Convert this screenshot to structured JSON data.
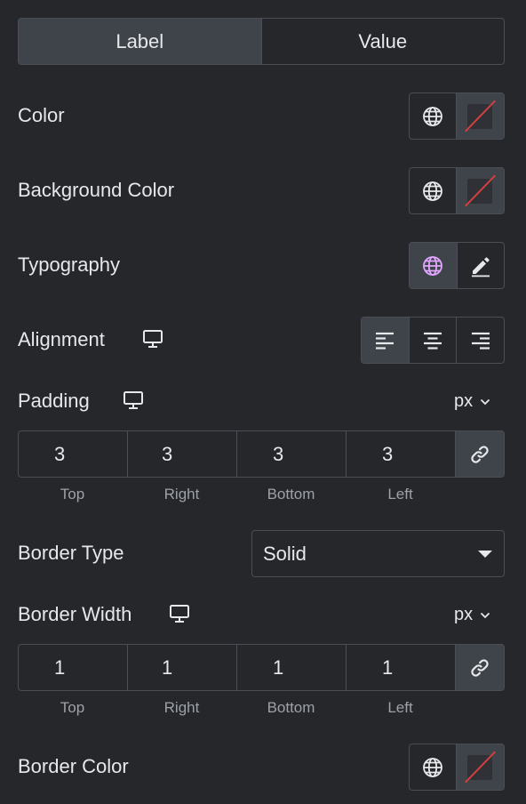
{
  "tabs": [
    {
      "label": "Label",
      "active": true
    },
    {
      "label": "Value",
      "active": false
    }
  ],
  "controls": {
    "color": {
      "label": "Color"
    },
    "background_color": {
      "label": "Background Color"
    },
    "typography": {
      "label": "Typography"
    },
    "alignment": {
      "label": "Alignment",
      "options": [
        "align-left-icon",
        "align-center-icon",
        "align-right-icon"
      ],
      "selected": "left"
    },
    "padding": {
      "label": "Padding",
      "unit": "px",
      "values": {
        "top": "3",
        "right": "3",
        "bottom": "3",
        "left": "3"
      },
      "sides": [
        "Top",
        "Right",
        "Bottom",
        "Left"
      ]
    },
    "border_type": {
      "label": "Border Type",
      "value": "Solid"
    },
    "border_width": {
      "label": "Border Width",
      "unit": "px",
      "values": {
        "top": "1",
        "right": "1",
        "bottom": "1",
        "left": "1"
      },
      "sides": [
        "Top",
        "Right",
        "Bottom",
        "Left"
      ]
    },
    "border_color": {
      "label": "Border Color"
    }
  },
  "colors": {
    "background": "#26272b",
    "panel_button": "#3f444b",
    "border": "#4b4e56",
    "text": "#e6e8ea",
    "muted_text": "#9da1a8",
    "accent_globe": "#e0a6ff",
    "clear_slash": "#d63f3f"
  }
}
